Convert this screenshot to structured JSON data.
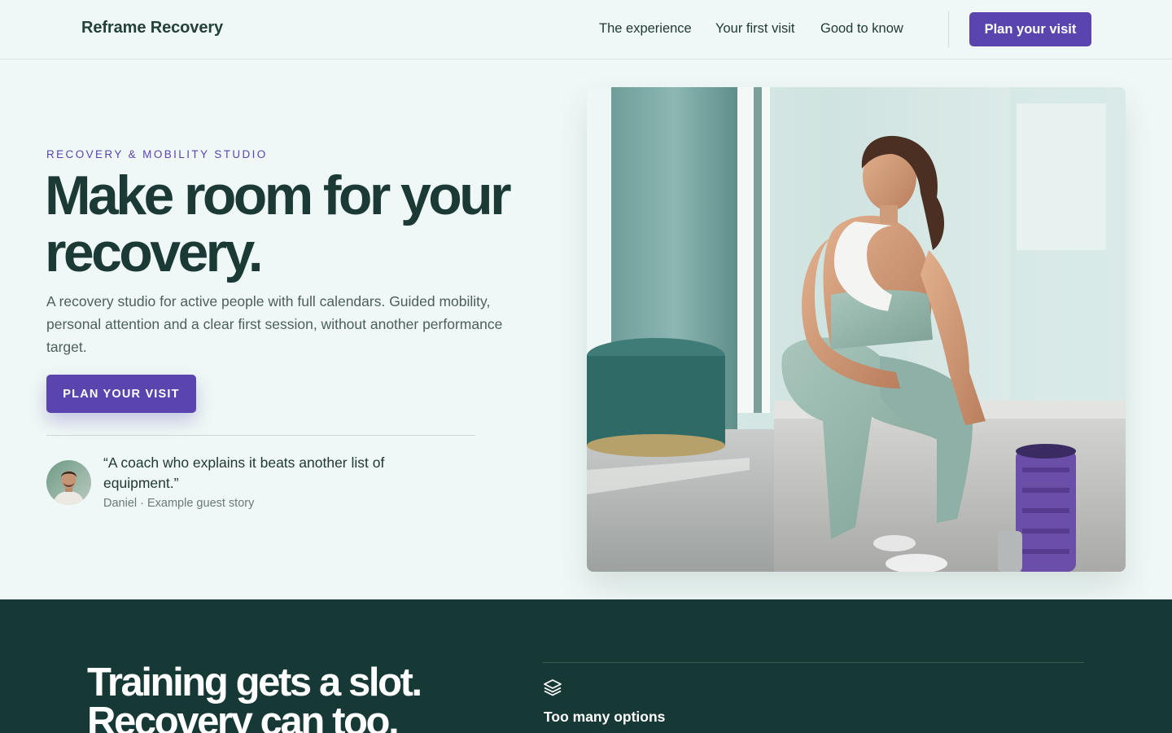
{
  "header": {
    "brand": "Reframe Recovery",
    "nav": [
      "The experience",
      "Your first visit",
      "Good to know"
    ],
    "cta_label": "Plan your visit"
  },
  "hero": {
    "eyebrow": "RECOVERY & MOBILITY STUDIO",
    "headline": "Make room for your recovery.",
    "lede": "A recovery studio for active people with full calendars. Guided mobility, personal attention and a clear first session, without another performance target.",
    "cta_label": "PLAN YOUR VISIT",
    "quote": "“A coach who explains it beats another list of equipment.”",
    "quote_cite": "Daniel · Example guest story"
  },
  "band": {
    "title": "Training gets a slot. Recovery can too.",
    "feature_icon": "layers-icon",
    "feature_title": "Too many options"
  },
  "colors": {
    "accent": "#5a44ae",
    "dark_band": "#173935",
    "page_bg": "#eff8f6",
    "heading": "#1c3a35"
  }
}
